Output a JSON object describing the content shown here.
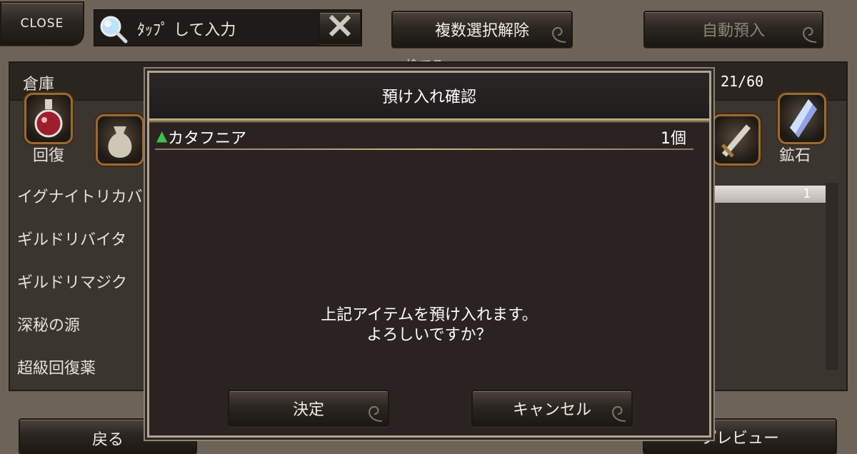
{
  "topbar": {
    "close_label": "CLOSE",
    "search_placeholder": "ﾀｯﾌﾟ して入力",
    "multi_deselect_label": "複数選択解除",
    "auto_deposit_label": "自動預入",
    "discard_label": "捨てる"
  },
  "storage": {
    "title": "倉庫",
    "capacity": "21/60",
    "categories": [
      {
        "label": "回復",
        "icon": "potion-icon"
      },
      {
        "label": "鉱石",
        "icon": "crystal-icon"
      }
    ],
    "items": [
      "イグナイトリカバ",
      "ギルドリバイタ",
      "ギルドリマジク",
      "深秘の源",
      "超級回復薬"
    ],
    "selected_qty": "1"
  },
  "bottom": {
    "back_label": "戻る",
    "preview_label": "プレビュー"
  },
  "modal": {
    "title": "預け入れ確認",
    "item": {
      "marker": "▲",
      "name": "カタフニア",
      "qty": "1個"
    },
    "message_line1": "上記アイテムを預け入れます。",
    "message_line2": "よろしいですか？",
    "confirm_label": "決定",
    "cancel_label": "キャンセル"
  },
  "colors": {
    "background": "#6d6457",
    "modal_bg": "#2b2322",
    "accent_green": "#3fc04a",
    "frame_gold": "#9a6a32"
  }
}
